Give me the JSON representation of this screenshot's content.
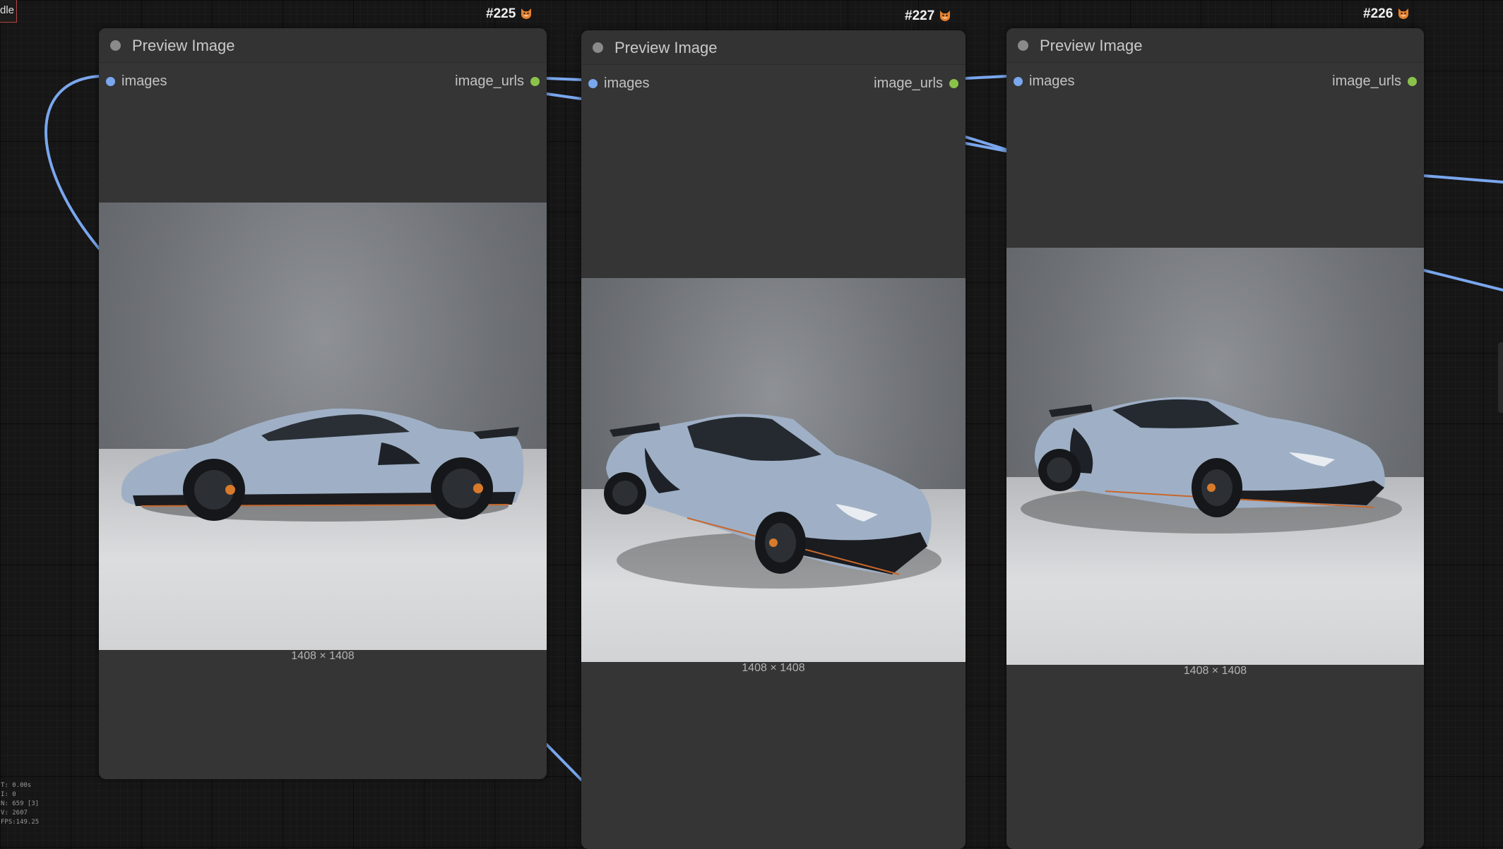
{
  "canvas": {
    "corner_label": "dle",
    "stats": [
      "T: 0.00s",
      "I: 0",
      "N: 659 [3]",
      "V: 2607",
      "FPS:149.25"
    ]
  },
  "nodes": [
    {
      "id_badge": "#225",
      "title": "Preview Image",
      "input": "images",
      "output": "image_urls",
      "dimensions": "1408 × 1408",
      "car_view": "side-profile-left",
      "car_color": "#9fb0c6"
    },
    {
      "id_badge": "#227",
      "title": "Preview Image",
      "input": "images",
      "output": "image_urls",
      "dimensions": "1408 × 1408",
      "car_view": "front-three-quarter",
      "car_color": "#9fb0c6"
    },
    {
      "id_badge": "#226",
      "title": "Preview Image",
      "input": "images",
      "output": "image_urls",
      "dimensions": "1408 × 1408",
      "car_view": "front-three-quarter-right",
      "car_color": "#9fb0c6"
    }
  ],
  "colors": {
    "link": "#7aa7ee",
    "input_slot": "#7aa7ee",
    "output_slot": "#8bc34a",
    "node_body": "#353535",
    "canvas_bg": "#161616"
  },
  "icons": {
    "badge_icon": "fox-icon",
    "title_dot": "node-status-dot"
  }
}
